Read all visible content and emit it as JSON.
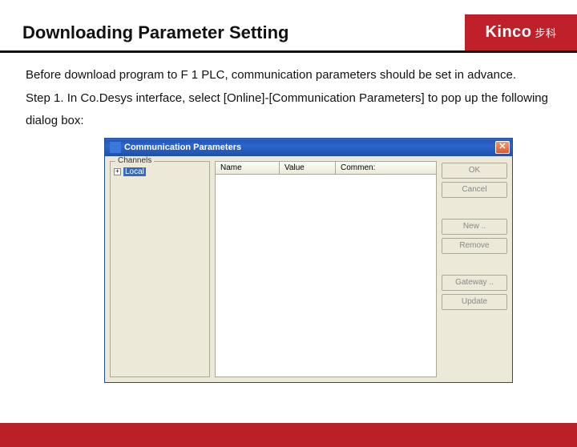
{
  "page": {
    "title": "Downloading Parameter Setting",
    "brand": "Kinco",
    "brand_cn": "步科",
    "para1": "Before download program to F 1 PLC, communication parameters should be set in advance.",
    "para2": "Step 1. In Co.Desys interface, select [Online]-[Communication Parameters] to pop up the following dialog box:"
  },
  "dialog": {
    "title": "Communication Parameters",
    "channels_label": "Channels",
    "tree_root": "Local",
    "columns": {
      "name": "Name",
      "value": "Value",
      "comment": "Commen:"
    },
    "buttons": {
      "ok": "OK",
      "cancel": "Cancel",
      "new": "New ..",
      "remove": "Remove",
      "gateway": "Gateway ..",
      "update": "Update"
    }
  }
}
